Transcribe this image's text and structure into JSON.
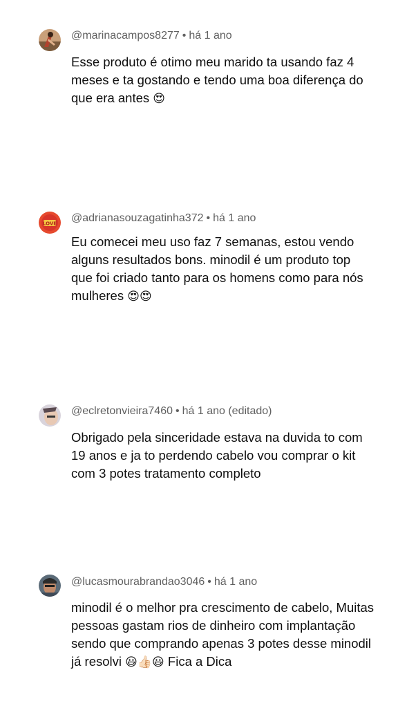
{
  "comments": [
    {
      "author": "@marinacampos8277",
      "time": "há 1 ano",
      "edited": "",
      "text": "Esse produto é otimo meu marido ta usando faz 4 meses e ta gostando e tendo uma boa diferença do que era antes",
      "emoji": "😍",
      "avatar_color": "#b1432d"
    },
    {
      "author": "@adrianasouzagatinha372",
      "time": "há 1 ano",
      "edited": "",
      "text": "Eu comecei meu uso faz 7 semanas, estou vendo alguns resultados bons. minodil é um produto top que foi criado tanto para os homens como para nós mulheres",
      "emoji": "😍😍",
      "avatar_color": "#d8352a"
    },
    {
      "author": "@eclretonvieira7460",
      "time": "há 1 ano",
      "edited": "(editado)",
      "text": "Obrigado pela sinceridade estava na duvida to com 19 anos e ja to perdendo cabelo vou comprar o kit com 3 potes tratamento completo",
      "emoji": "",
      "avatar_color": "#c7c2cc"
    },
    {
      "author": "@lucasmourabrandao3046",
      "time": "há 1 ano",
      "edited": "",
      "text": "minodil é o melhor pra crescimento de cabelo, Muitas pessoas gastam rios de dinheiro com implantação sendo que comprando apenas 3 potes desse minodil já resolvi",
      "emoji": "😃👍🏻😃",
      "text_after": "Fica a Dica",
      "avatar_color": "#3f4a57"
    }
  ]
}
